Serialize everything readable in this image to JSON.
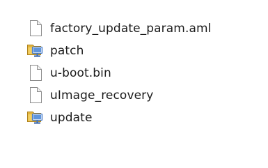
{
  "files": [
    {
      "name": "factory_update_param.aml",
      "icon": "document-icon",
      "type": "file"
    },
    {
      "name": "patch",
      "icon": "network-folder-icon",
      "type": "folder"
    },
    {
      "name": "u-boot.bin",
      "icon": "document-icon",
      "type": "file"
    },
    {
      "name": "uImage_recovery",
      "icon": "document-icon",
      "type": "file"
    },
    {
      "name": "update",
      "icon": "network-folder-icon",
      "type": "folder"
    }
  ],
  "colors": {
    "text": "#1b1b1b",
    "folder": "#e2b43c",
    "monitor": "#3d73c4"
  }
}
